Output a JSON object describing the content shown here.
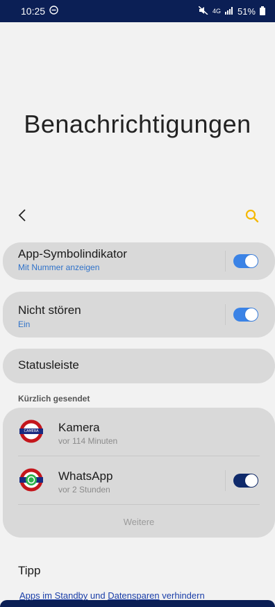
{
  "status_bar": {
    "time": "10:25",
    "signal_text": "4G",
    "battery": "51%"
  },
  "page": {
    "title": "Benachrichtigungen"
  },
  "settings": [
    {
      "title": "App-Symbolindikator",
      "subtitle": "Mit Nummer anzeigen",
      "toggle": true
    },
    {
      "title": "Nicht stören",
      "subtitle": "Ein",
      "toggle": true
    },
    {
      "title": "Statusleiste"
    }
  ],
  "recent": {
    "label": "Kürzlich gesendet",
    "apps": [
      {
        "name": "Kamera",
        "time": "vor 114 Minuten",
        "icon": "camera-app-icon",
        "icon_text": "CAMERA"
      },
      {
        "name": "WhatsApp",
        "time": "vor 2 Stunden",
        "icon": "whatsapp-app-icon",
        "toggle": true
      }
    ],
    "more_label": "Weitere"
  },
  "tipp": {
    "title": "Tipp",
    "text_parts": [
      "Apps im Standby",
      " und ",
      "Datensparen",
      " verhindern"
    ]
  },
  "colors": {
    "accent": "#3b83e6",
    "statusbar": "#0b1f55",
    "search": "#f5b800"
  }
}
